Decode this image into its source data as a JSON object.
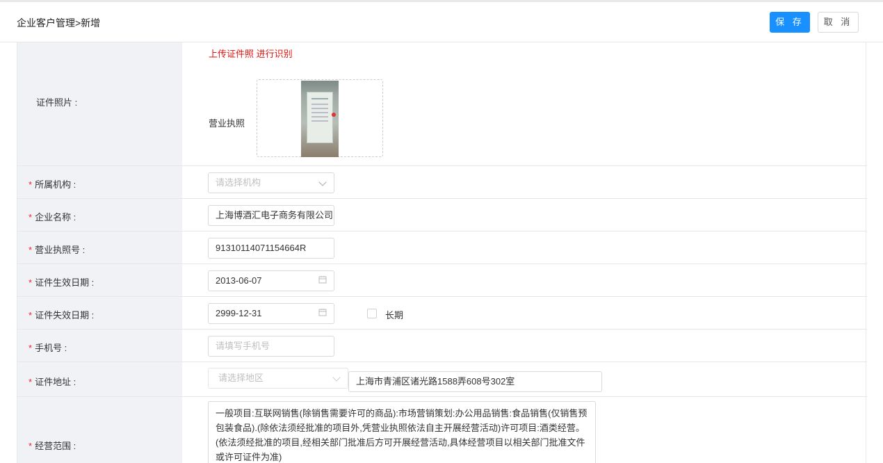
{
  "header": {
    "breadcrumb": "企业客户管理>新增",
    "save_label": "保 存",
    "cancel_label": "取 消"
  },
  "form": {
    "photo": {
      "label": "证件照片 :",
      "upload_link": "上传证件照 进行识别",
      "license_label": "营业执照"
    },
    "org": {
      "required": "*",
      "label": "所属机构 :",
      "placeholder": "请选择机构"
    },
    "company_name": {
      "required": "*",
      "label": "企业名称 :",
      "value": "上海博酒汇电子商务有限公司"
    },
    "license_no": {
      "required": "*",
      "label": "营业执照号 :",
      "value": "91310114071154664R"
    },
    "start_date": {
      "required": "*",
      "label": "证件生效日期 :",
      "value": "2013-06-07",
      "icon": "calendar-icon"
    },
    "end_date": {
      "required": "*",
      "label": "证件失效日期 :",
      "value": "2999-12-31",
      "icon": "calendar-icon",
      "long_term_label": "长期"
    },
    "phone": {
      "required": "*",
      "label": "手机号 :",
      "placeholder": "请填写手机号"
    },
    "address": {
      "required": "*",
      "label": "证件地址 :",
      "region_placeholder": "请选择地区",
      "detail": "上海市青浦区诸光路1588弄608号302室"
    },
    "scope": {
      "required": "*",
      "label": "经营范围 :",
      "value": "一般项目:互联网销售(除销售需要许可的商品):市场营销策划:办公用品销售:食品销售(仅销售预包装食品).(除依法须经批准的项目外,凭营业执照依法自主开展经营活动)许可项目:酒类经营。(依法须经批准的项目,经相关部门批准后方可开展经营活动,具体经营项目以相关部门批准文件或许可证件为准)"
    }
  },
  "colors": {
    "primary": "#1890ff",
    "required": "#f5222d",
    "link_red": "#e0120f",
    "label_bg": "#f0f2f5"
  }
}
